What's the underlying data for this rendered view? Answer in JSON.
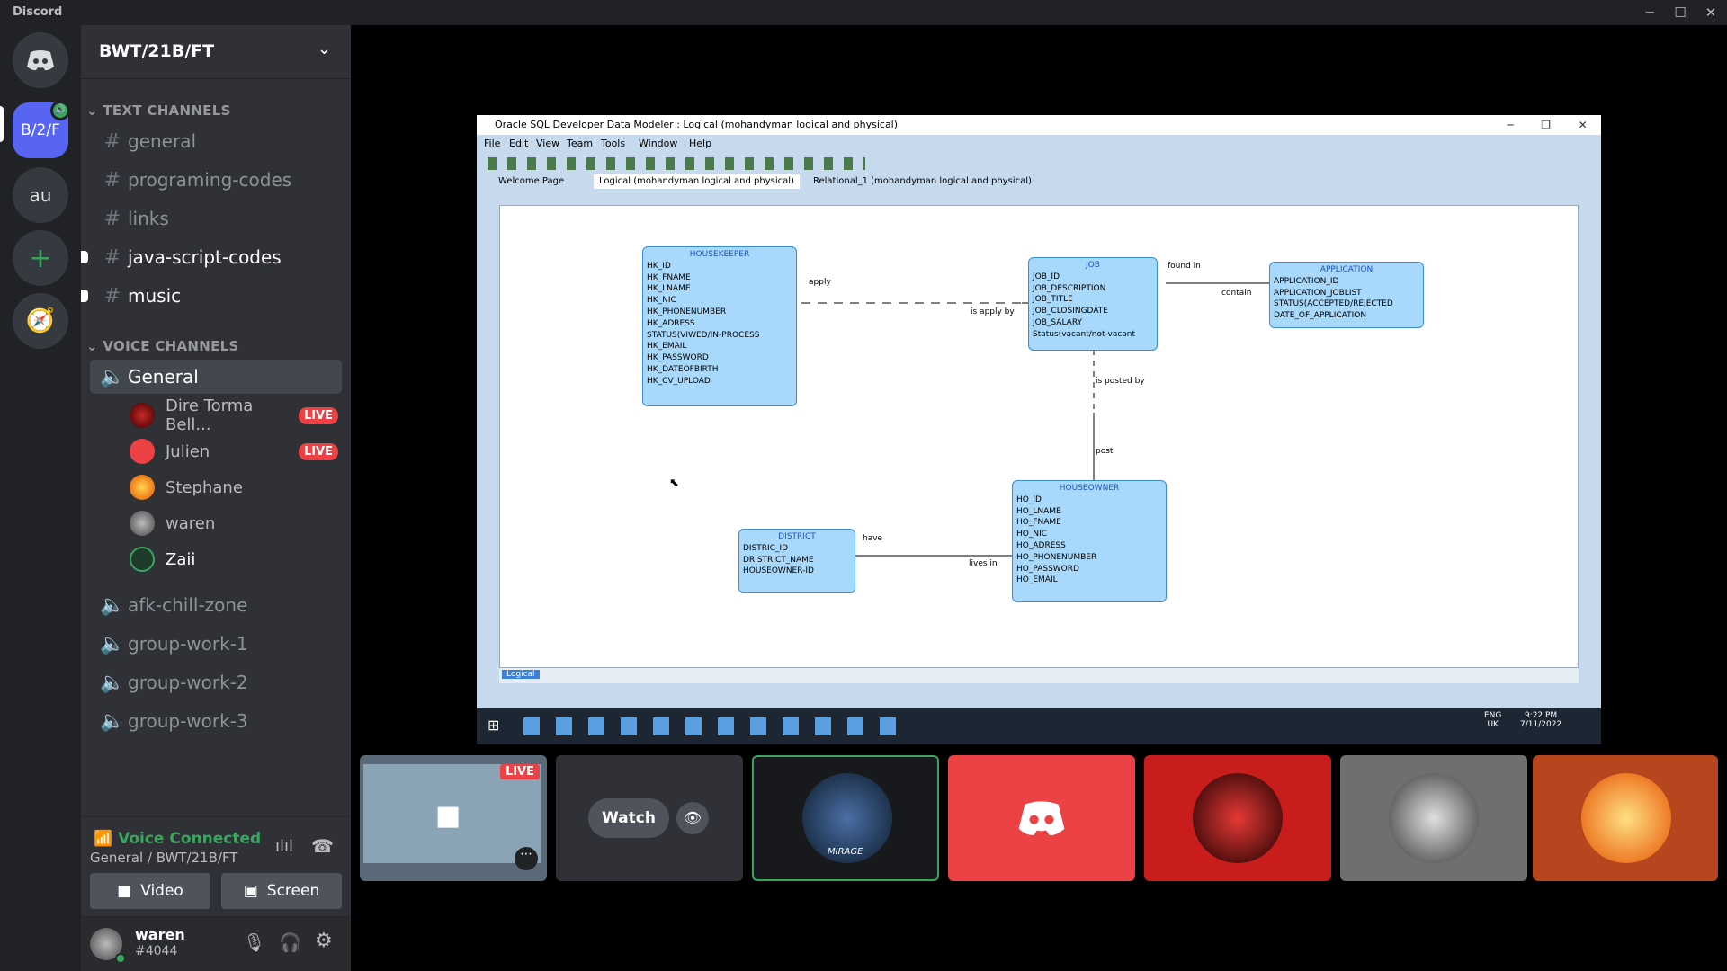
{
  "window": {
    "app_title": "Discord"
  },
  "guilds": {
    "selected_label": "B/2/F",
    "item2": "au"
  },
  "server": {
    "name": "BWT/21B/FT"
  },
  "text_channels": {
    "category": "TEXT CHANNELS",
    "items": [
      "general",
      "programing-codes",
      "links",
      "java-script-codes",
      "music"
    ]
  },
  "voice_channels": {
    "category": "VOICE CHANNELS",
    "active": "General",
    "others": [
      "afk-chill-zone",
      "group-work-1",
      "group-work-2",
      "group-work-3"
    ]
  },
  "voice_users": [
    {
      "name": "Dire Torma Bell...",
      "live": "LIVE"
    },
    {
      "name": "Julien",
      "live": "LIVE"
    },
    {
      "name": "Stephane"
    },
    {
      "name": "waren"
    },
    {
      "name": "Zaii"
    }
  ],
  "voice_panel": {
    "status": "Voice Connected",
    "location": "General / BWT/21B/FT",
    "video": "Video",
    "screen": "Screen"
  },
  "user": {
    "name": "waren",
    "tag": "#4044"
  },
  "stream": {
    "title": "Oracle SQL Developer Data Modeler : Logical (mohandyman logical and physical)",
    "menu": [
      "File",
      "Edit",
      "View",
      "Team",
      "Tools",
      "Window",
      "Help"
    ],
    "tabs": [
      "Welcome Page",
      "Logical (mohandyman logical and physical)",
      "Relational_1 (mohandyman logical and physical)"
    ],
    "bottom_tab": "Logical",
    "clock": "9:22 PM",
    "date": "7/11/2022",
    "lang": "ENG",
    "region": "UK",
    "entities": {
      "housekeeper": {
        "title": "HOUSEKEEPER",
        "fields": [
          "HK_ID",
          "HK_FNAME",
          "HK_LNAME",
          "HK_NIC",
          "HK_PHONENUMBER",
          "HK_ADRESS",
          "STATUS(VIWED/IN-PROCESS",
          "HK_EMAIL",
          "HK_PASSWORD",
          "HK_DATEOFBIRTH",
          "HK_CV_UPLOAD"
        ]
      },
      "job": {
        "title": "JOB",
        "fields": [
          "JOB_ID",
          "JOB_DESCRIPTION",
          "JOB_TITLE",
          "JOB_CLOSINGDATE",
          "JOB_SALARY",
          "Status(vacant/not-vacant"
        ]
      },
      "application": {
        "title": "APPLICATION",
        "fields": [
          "APPLICATION_ID",
          "APPLICATION_JOBLIST",
          "STATUS(ACCEPTED/REJECTED",
          "DATE_OF_APPLICATION"
        ]
      },
      "houseowner": {
        "title": "HOUSEOWNER",
        "fields": [
          "HO_ID",
          "HO_LNAME",
          "HO_FNAME",
          "HO_NIC",
          "HO_ADRESS",
          "HO_PHONENUMBER",
          "HO_PASSWORD",
          "HO_EMAIL"
        ]
      },
      "district": {
        "title": "DISTRICT",
        "fields": [
          "DISTRIC_ID",
          "DRISTRICT_NAME",
          "HOUSEOWNER-ID"
        ]
      }
    },
    "relations": {
      "apply": "apply",
      "is_apply_by": "is apply by",
      "found_in": "found in",
      "contain": "contain",
      "is_posted_by": "is posted by",
      "post": "post",
      "have": "have",
      "lives_in": "lives in"
    }
  },
  "tiles": {
    "live_badge": "LIVE",
    "watch": "Watch",
    "mirage": "MIRAGE"
  }
}
